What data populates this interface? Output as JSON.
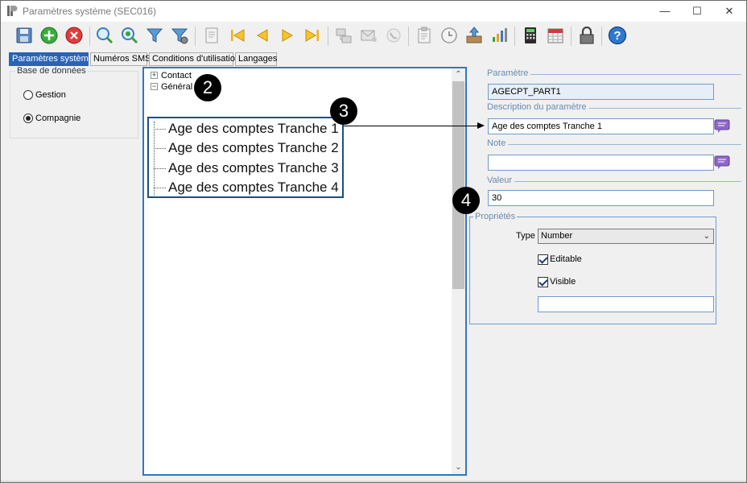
{
  "window": {
    "title": "Paramètres système (SEC016)",
    "minimize": "—",
    "maximize": "☐",
    "close": "✕"
  },
  "toolbar": {
    "buttons": [
      "save-icon",
      "add-icon",
      "delete-icon",
      "search-icon",
      "refresh-search-icon",
      "filter-icon",
      "filter-settings-icon",
      "report-icon",
      "first-icon",
      "previous-icon",
      "next-icon",
      "last-icon",
      "network-icon",
      "mail-icon",
      "phone-icon",
      "clipboard-icon",
      "history-icon",
      "export-icon",
      "chart-icon",
      "calculator-icon",
      "calendar-icon",
      "lock-icon",
      "help-icon"
    ]
  },
  "tabs": [
    {
      "label": "Paramètres système",
      "active": true
    },
    {
      "label": "Numéros SMS",
      "active": false
    },
    {
      "label": "Conditions d'utilisation",
      "active": false
    },
    {
      "label": "Langages",
      "active": false
    }
  ],
  "database": {
    "legend": "Base de données",
    "options": [
      {
        "label": "Gestion",
        "selected": false
      },
      {
        "label": "Compagnie",
        "selected": true
      }
    ]
  },
  "tree": {
    "nodes": [
      {
        "label": "Contact",
        "expander": "+"
      },
      {
        "label": "Général",
        "expander": "−"
      }
    ],
    "zoom_items": [
      "Age des comptes Tranche 1",
      "Age des comptes Tranche 2",
      "Age des comptes Tranche 3",
      "Age des comptes Tranche 4"
    ],
    "scroll_up": "⌃",
    "scroll_down": "⌄"
  },
  "callouts": [
    "2",
    "3",
    "4"
  ],
  "details": {
    "parametre_label": "Paramètre",
    "parametre_value": "AGECPT_PART1",
    "description_label": "Description du paramètre",
    "description_value": "Age des comptes Tranche 1",
    "note_label": "Note",
    "note_value": "",
    "valeur_label": "Valeur",
    "valeur_value": "30"
  },
  "properties": {
    "legend": "Propriétés",
    "type_label": "Type",
    "type_value": "Number",
    "chevron": "⌄",
    "editable_label": "Editable",
    "editable_checked": true,
    "visible_label": "Visible",
    "visible_checked": true,
    "extra_value": ""
  }
}
